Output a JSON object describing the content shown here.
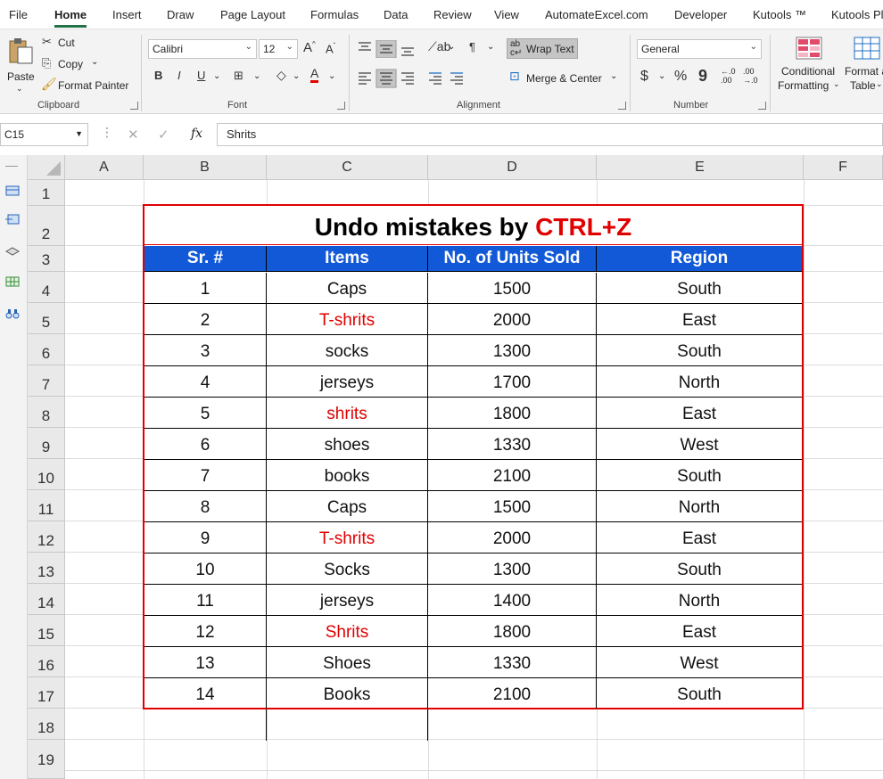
{
  "ribbon_tabs": [
    "File",
    "Home",
    "Insert",
    "Draw",
    "Page Layout",
    "Formulas",
    "Data",
    "Review",
    "View",
    "AutomateExcel.com",
    "Developer",
    "Kutools ™",
    "Kutools Pl"
  ],
  "active_tab": "Home",
  "clipboard": {
    "paste": "Paste",
    "cut": "Cut",
    "copy": "Copy",
    "format_painter": "Format Painter",
    "label": "Clipboard"
  },
  "font": {
    "name": "Calibri",
    "size": "12",
    "bold": "B",
    "italic": "I",
    "underline": "U",
    "label": "Font",
    "grow": "A",
    "shrink": "A"
  },
  "alignment": {
    "wrap_text": "Wrap Text",
    "merge_center": "Merge & Center",
    "label": "Alignment"
  },
  "number": {
    "format": "General",
    "label": "Number",
    "currency": "$",
    "percent": "%",
    "comma": "9",
    "inc_decimal": "←.0\n.00",
    "dec_decimal": ".00\n→.0"
  },
  "styles": {
    "conditional": "Conditional",
    "formatting": "Formatting",
    "format_as": "Format a",
    "table": "Table"
  },
  "formula_bar": {
    "name_box": "C15",
    "cancel": "✕",
    "enter": "✓",
    "fx": "fx",
    "content": "Shrits"
  },
  "columns": [
    "A",
    "B",
    "C",
    "D",
    "E",
    "F"
  ],
  "rows": [
    "1",
    "2",
    "3",
    "4",
    "5",
    "6",
    "7",
    "8",
    "9",
    "10",
    "11",
    "12",
    "13",
    "14",
    "15",
    "16",
    "17",
    "18",
    "19"
  ],
  "sheet": {
    "title_prefix": "Undo mistakes by ",
    "title_highlight": "CTRL+Z",
    "title_highlight_color": "#e00000",
    "header_color": "#1259d8",
    "table_border_color": "#e00000",
    "headers": [
      "Sr. #",
      "Items",
      "No. of Units Sold",
      "Region"
    ],
    "rows": [
      {
        "sr": "1",
        "item": "Caps",
        "units": "1500",
        "region": "South",
        "item_red": false
      },
      {
        "sr": "2",
        "item": "T-shrits",
        "units": "2000",
        "region": "East",
        "item_red": true
      },
      {
        "sr": "3",
        "item": "socks",
        "units": "1300",
        "region": "South",
        "item_red": false
      },
      {
        "sr": "4",
        "item": "jerseys",
        "units": "1700",
        "region": "North",
        "item_red": false
      },
      {
        "sr": "5",
        "item": "shrits",
        "units": "1800",
        "region": "East",
        "item_red": true
      },
      {
        "sr": "6",
        "item": "shoes",
        "units": "1330",
        "region": "West",
        "item_red": false
      },
      {
        "sr": "7",
        "item": "books",
        "units": "2100",
        "region": "South",
        "item_red": false
      },
      {
        "sr": "8",
        "item": "Caps",
        "units": "1500",
        "region": "North",
        "item_red": false
      },
      {
        "sr": "9",
        "item": "T-shrits",
        "units": "2000",
        "region": "East",
        "item_red": true
      },
      {
        "sr": "10",
        "item": "Socks",
        "units": "1300",
        "region": "South",
        "item_red": false
      },
      {
        "sr": "11",
        "item": "jerseys",
        "units": "1400",
        "region": "North",
        "item_red": false
      },
      {
        "sr": "12",
        "item": "Shrits",
        "units": "1800",
        "region": "East",
        "item_red": true
      },
      {
        "sr": "13",
        "item": "Shoes",
        "units": "1330",
        "region": "West",
        "item_red": false
      },
      {
        "sr": "14",
        "item": "Books",
        "units": "2100",
        "region": "South",
        "item_red": false
      }
    ]
  }
}
